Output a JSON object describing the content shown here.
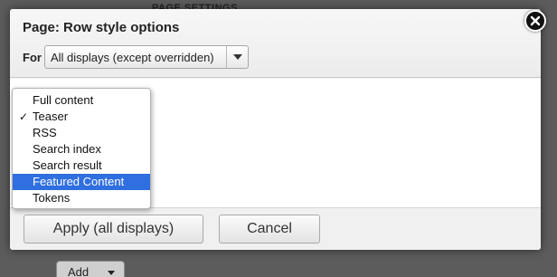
{
  "background": {
    "heading": "PAGE SETTINGS",
    "add_button_label": "Add"
  },
  "dialog": {
    "title": "Page: Row style options",
    "for_label": "For",
    "for_select_value": "All displays (except overridden)",
    "close_icon": "close-circle-icon",
    "apply_label": "Apply (all displays)",
    "cancel_label": "Cancel"
  },
  "dropdown": {
    "checked_index": 1,
    "highlighted_index": 5,
    "options": [
      "Full content",
      "Teaser",
      "RSS",
      "Search index",
      "Search result",
      "Featured Content",
      "Tokens"
    ],
    "checkmark": "✓"
  },
  "colors": {
    "highlight": "#2f6fe0",
    "overlay": "#5c5c5c"
  }
}
